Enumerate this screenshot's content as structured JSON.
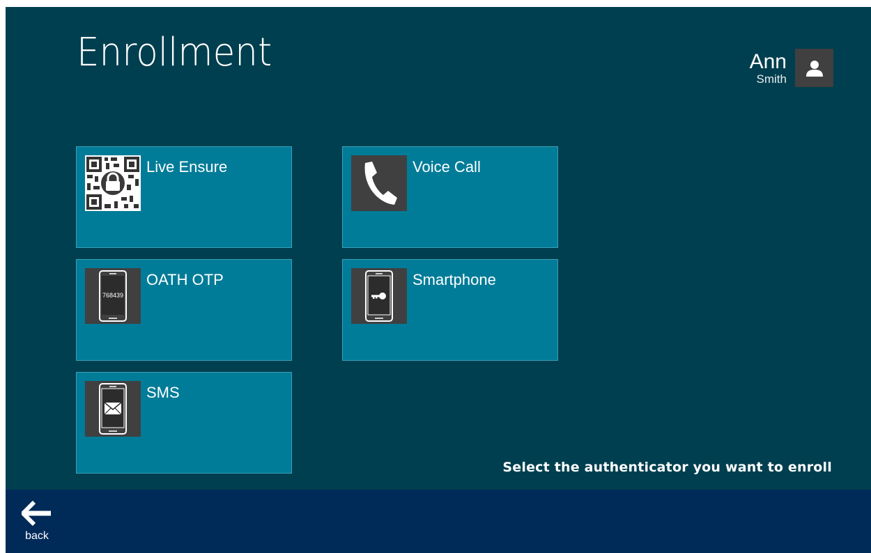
{
  "page": {
    "title": "Enrollment",
    "hint": "Select the authenticator you want to enroll"
  },
  "user": {
    "first_name": "Ann",
    "last_name": "Smith",
    "avatar_icon": "person-icon"
  },
  "tiles": [
    {
      "label": "Live Ensure",
      "icon": "qr-lock-icon"
    },
    {
      "label": "Voice Call",
      "icon": "phone-handset-icon"
    },
    {
      "label": "OATH OTP",
      "icon": "token-phone-icon",
      "icon_text": "768439"
    },
    {
      "label": "Smartphone",
      "icon": "smartphone-key-icon"
    },
    {
      "label": "SMS",
      "icon": "sms-phone-icon"
    }
  ],
  "footer": {
    "back_label": "back",
    "back_icon": "arrow-left-icon"
  },
  "colors": {
    "background": "#003f4f",
    "tile": "#007c98",
    "tile_border": "#3aa0b8",
    "icon_bg": "#404040",
    "bottom_bar": "#002a58"
  }
}
